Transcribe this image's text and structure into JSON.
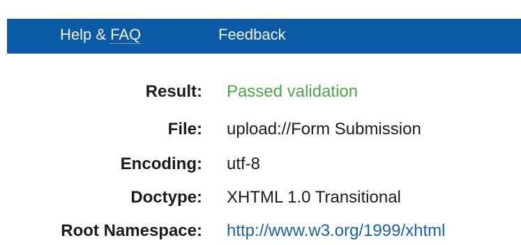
{
  "nav": {
    "help_label_prefix": "Help & ",
    "help_label_abbr": "FAQ",
    "feedback_label": "Feedback"
  },
  "results": {
    "result": {
      "label": "Result:",
      "value": "Passed validation"
    },
    "file": {
      "label": "File:",
      "value": "upload://Form Submission"
    },
    "encoding": {
      "label": "Encoding:",
      "value": "utf-8"
    },
    "doctype": {
      "label": "Doctype:",
      "value": "XHTML 1.0 Transitional"
    },
    "root_namespace": {
      "label": "Root Namespace:",
      "value": "http://www.w3.org/1999/xhtml"
    }
  },
  "colors": {
    "nav_bg": "#0a5aa5",
    "passed": "#4aa54a",
    "link": "#1761a9"
  }
}
